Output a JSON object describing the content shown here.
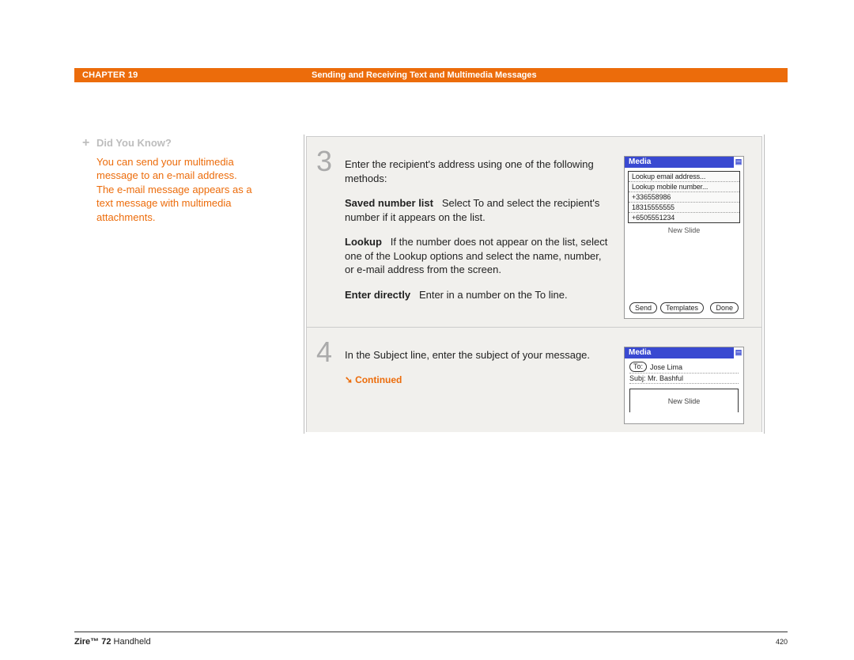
{
  "header": {
    "chapter": "CHAPTER 19",
    "title": "Sending and Receiving Text and Multimedia Messages"
  },
  "sidebar": {
    "heading": "Did You Know?",
    "body": "You can send your multimedia message to an e-mail address. The e-mail message appears as a text message with multimedia attachments."
  },
  "steps": [
    {
      "num": "3",
      "intro": "Enter the recipient's address using one of the following methods:",
      "items": [
        {
          "label": "Saved number list",
          "text": "Select To and select the recipient's number if it appears on the list."
        },
        {
          "label": "Lookup",
          "text": "If the number does not appear on the list, select one of the Lookup options and select the name, number, or e-mail address from the screen."
        },
        {
          "label": "Enter directly",
          "text": "Enter in a number on the To line."
        }
      ]
    },
    {
      "num": "4",
      "intro": "In the Subject line, enter the subject of your message.",
      "continued": "Continued"
    }
  ],
  "device1": {
    "title": "Media",
    "rows": [
      "Lookup email address...",
      "Lookup mobile number...",
      "+336558986",
      "18315555555",
      "+6505551234"
    ],
    "under": "New Slide",
    "buttons": {
      "send": "Send",
      "templates": "Templates",
      "done": "Done"
    }
  },
  "device2": {
    "title": "Media",
    "to_label": "To:",
    "to_value": "Jose Lima",
    "subj_label": "Subj:",
    "subj_value": "Mr. Bashful",
    "slide": "New Slide"
  },
  "footer": {
    "product_bold": "Zire™ 72",
    "product_rest": " Handheld",
    "page": "420"
  }
}
